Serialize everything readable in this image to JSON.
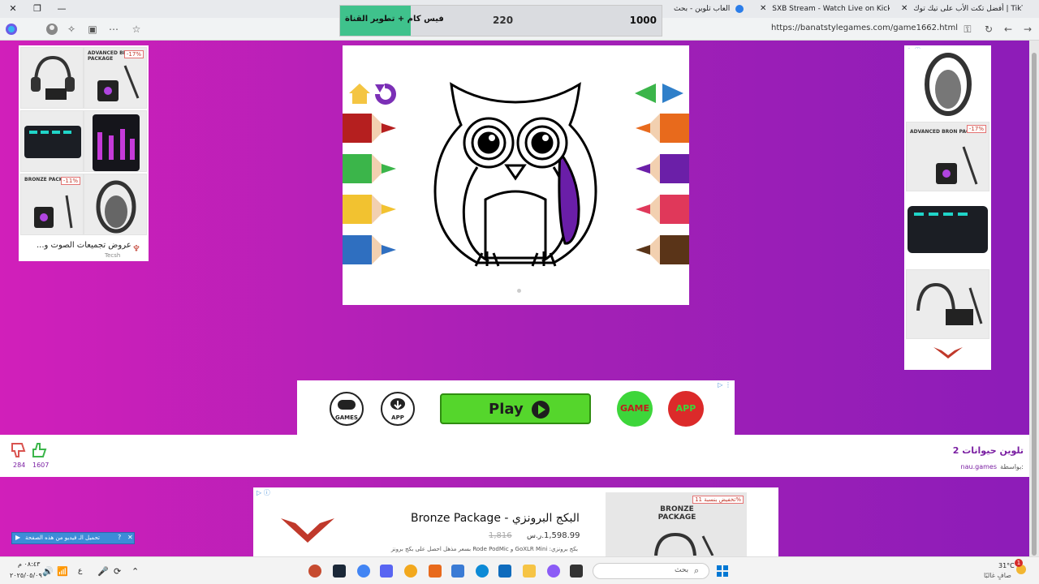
{
  "browser": {
    "tabs": [
      {
        "label": "أفضل تكت الأب على تيك توك | TikTok",
        "favicon_color": "#111111"
      },
      {
        "label": "SXB Stream - Watch Live on Kick",
        "favicon_color": "#53fc18"
      },
      {
        "label": "العاب تلوين - بحث",
        "favicon_color": "#2b7de9"
      }
    ],
    "url": "https://banatstylegames.com/game1662.html"
  },
  "stream_widget": {
    "goal_label": "فيس كام + تطوير القناة",
    "current": "220",
    "target": "1000",
    "progress": 0.22
  },
  "left_ad": {
    "products": [
      {
        "tag": ""
      },
      {
        "badge_text": "ADVANCED BRO PACKAGE",
        "tag": "-17%"
      },
      {
        "tag": ""
      },
      {
        "badge_text": "GoXLR",
        "tag": ""
      },
      {
        "badge_text": "BRONZE PACKAGE",
        "tag": "-11%"
      },
      {
        "tag": ""
      }
    ],
    "caption": "عروض تجميعات الصوت و...",
    "brand": "Tecsh"
  },
  "right_ad": {
    "products": [
      {
        "tag": ""
      },
      {
        "badge_text": "ADVANCED BRON PACKAGE",
        "tag": "-17%"
      },
      {
        "badge_text": "GO XLR",
        "tag": ""
      },
      {
        "tag": ""
      }
    ]
  },
  "game": {
    "left_pencils": [
      "#b51f1f",
      "#3bb54a",
      "#f2c230",
      "#2f6fc0"
    ],
    "right_pencils": [
      "#e86a1c",
      "#6b1fa8",
      "#e0385a",
      "#5a3418"
    ],
    "owl_fill": "#6a1ea8"
  },
  "store_bar": {
    "games_label": "GAMES",
    "app_label": "APP",
    "play_label": "Play",
    "game_btn": "GAME",
    "app_btn": "APP"
  },
  "info": {
    "title": "تلوين حيوانات 2",
    "by_label": "بواسطة:",
    "author": "nau.games",
    "dislikes": "284",
    "likes": "1607"
  },
  "bottom_ad": {
    "title": "Bronze Package - البكج البرونزي",
    "price": "1,598.99",
    "currency": "ر.س.",
    "old_price": "1,816",
    "desc": "بكج برونزي: GoXLR Mini و Rode PodMic بسعر مذهل احصل على بكج برونز",
    "discount_tag": "تخفيض بنسبة 11%",
    "package_label": "BRONZE PACKAGE"
  },
  "video_bar": {
    "label": "تحميل الـ فيديو من هذه الصفحة"
  },
  "taskbar": {
    "time": "٠٨:٤٣ م",
    "date": "٢٠٢٥/٠٥/٠٩",
    "lang": "ع",
    "search_placeholder": "بحث",
    "weather_temp": "31°C",
    "weather_text": "صافٍ غالبًا",
    "notification_count": "1"
  }
}
